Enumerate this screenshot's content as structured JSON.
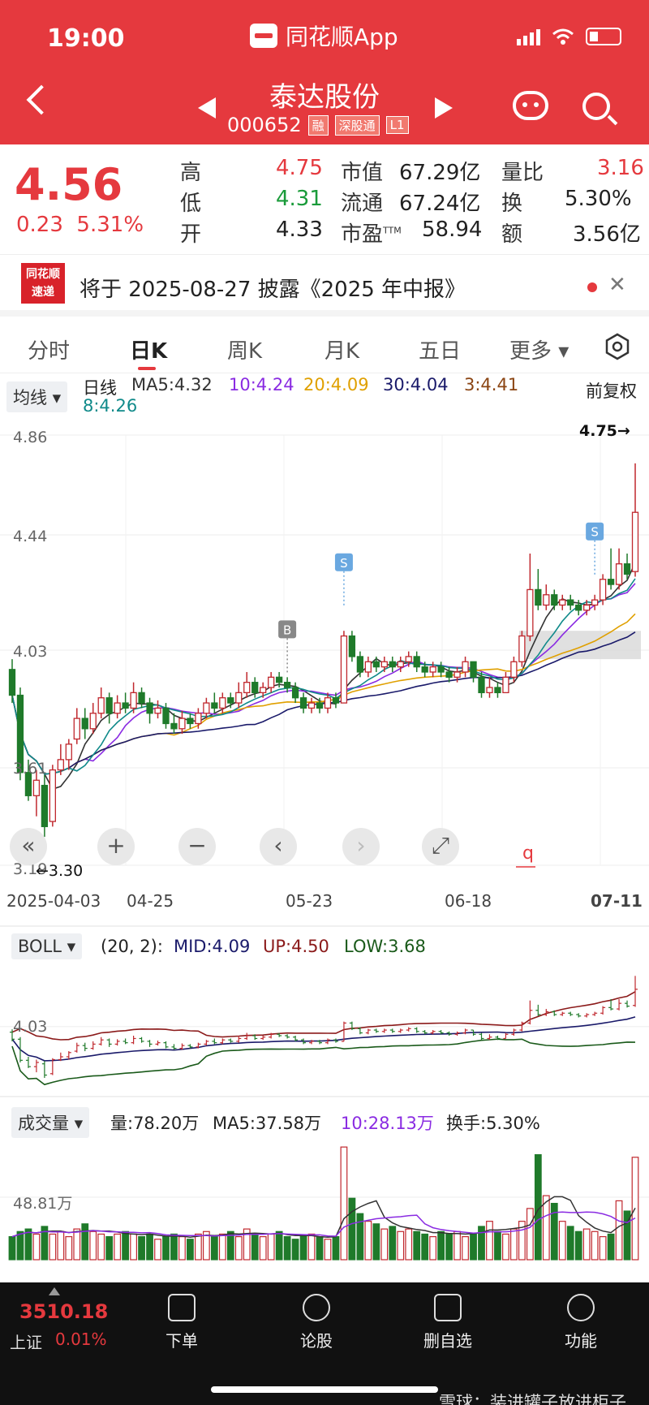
{
  "status_bar": {
    "time": "19:00",
    "app_name": "同花顺App"
  },
  "header": {
    "stock_name": "泰达股份",
    "stock_code": "000652",
    "tags": [
      "融",
      "深股通",
      "L1"
    ]
  },
  "quote": {
    "price": "4.56",
    "change": "0.23",
    "change_pct": "5.31%",
    "stats": [
      {
        "label": "高",
        "value": "4.75",
        "color": "#e5393e"
      },
      {
        "label": "低",
        "value": "4.31",
        "color": "#1a9b3a"
      },
      {
        "label": "开",
        "value": "4.33",
        "color": "#222222"
      },
      {
        "label": "市值",
        "value": "67.29亿",
        "color": "#222222"
      },
      {
        "label": "流通",
        "value": "67.24亿",
        "color": "#222222"
      },
      {
        "label": "市盈",
        "sup": "TTM",
        "value": "58.94",
        "color": "#222222"
      },
      {
        "label": "量比",
        "value": "3.16",
        "color": "#e5393e"
      },
      {
        "label": "换",
        "value": "5.30%",
        "color": "#222222"
      },
      {
        "label": "额",
        "value": "3.56亿",
        "color": "#222222"
      }
    ]
  },
  "news": {
    "logo_top": "同花顺",
    "logo_bottom": "速递",
    "text": "将于 2025-08-27 披露《2025 年中报》"
  },
  "tabs": [
    "分时",
    "日K",
    "周K",
    "月K",
    "五日",
    "更多"
  ],
  "active_tab": "日K",
  "ma_bar": {
    "selector": "均线",
    "label": "日线",
    "items": [
      {
        "text": "MA5:4.32",
        "color": "#333333"
      },
      {
        "text": "10:4.24",
        "color": "#8a2be2"
      },
      {
        "text": "20:4.09",
        "color": "#e0a000"
      },
      {
        "text": "30:4.04",
        "color": "#1a1a6a"
      },
      {
        "text": "3:4.41",
        "color": "#8b4513"
      },
      {
        "text": "8:4.26",
        "color": "#108a8a"
      }
    ],
    "adjust": "前复权"
  },
  "chart_data": {
    "type": "candlestick",
    "ylim": [
      3.19,
      4.86
    ],
    "y_ticks": [
      "4.86",
      "4.44",
      "4.03",
      "3.61",
      "3.19"
    ],
    "x_ticks": [
      "2025-04-03",
      "04-25",
      "05-23",
      "06-18",
      "07-11"
    ],
    "high_marker": "4.75",
    "low_marker": "3.30",
    "signals": [
      {
        "type": "B"
      },
      {
        "type": "S"
      },
      {
        "type": "S"
      }
    ],
    "candles": [
      [
        3.95,
        3.85,
        3.99,
        3.82
      ],
      [
        3.85,
        3.55,
        3.88,
        3.52
      ],
      [
        3.55,
        3.46,
        3.6,
        3.44
      ],
      [
        3.46,
        3.52,
        3.56,
        3.38
      ],
      [
        3.5,
        3.34,
        3.54,
        3.3
      ],
      [
        3.36,
        3.56,
        3.58,
        3.34
      ],
      [
        3.56,
        3.6,
        3.66,
        3.54
      ],
      [
        3.6,
        3.66,
        3.68,
        3.56
      ],
      [
        3.68,
        3.76,
        3.8,
        3.66
      ],
      [
        3.76,
        3.72,
        3.8,
        3.68
      ],
      [
        3.72,
        3.78,
        3.82,
        3.7
      ],
      [
        3.78,
        3.84,
        3.88,
        3.76
      ],
      [
        3.84,
        3.78,
        3.86,
        3.74
      ],
      [
        3.78,
        3.82,
        3.85,
        3.76
      ],
      [
        3.82,
        3.8,
        3.86,
        3.78
      ],
      [
        3.8,
        3.86,
        3.9,
        3.78
      ],
      [
        3.86,
        3.82,
        3.88,
        3.8
      ],
      [
        3.82,
        3.78,
        3.84,
        3.74
      ],
      [
        3.78,
        3.8,
        3.83,
        3.76
      ],
      [
        3.8,
        3.74,
        3.82,
        3.72
      ],
      [
        3.74,
        3.72,
        3.78,
        3.7
      ],
      [
        3.72,
        3.76,
        3.79,
        3.7
      ],
      [
        3.76,
        3.74,
        3.78,
        3.72
      ],
      [
        3.74,
        3.78,
        3.8,
        3.72
      ],
      [
        3.78,
        3.82,
        3.84,
        3.76
      ],
      [
        3.82,
        3.8,
        3.86,
        3.78
      ],
      [
        3.8,
        3.84,
        3.86,
        3.78
      ],
      [
        3.84,
        3.82,
        3.86,
        3.8
      ],
      [
        3.82,
        3.86,
        3.9,
        3.8
      ],
      [
        3.86,
        3.9,
        3.94,
        3.84
      ],
      [
        3.9,
        3.86,
        3.92,
        3.84
      ],
      [
        3.86,
        3.88,
        3.9,
        3.84
      ],
      [
        3.88,
        3.92,
        3.94,
        3.86
      ],
      [
        3.92,
        3.9,
        3.94,
        3.88
      ],
      [
        3.9,
        3.88,
        3.92,
        3.86
      ],
      [
        3.88,
        3.84,
        3.9,
        3.82
      ],
      [
        3.84,
        3.8,
        3.86,
        3.78
      ],
      [
        3.8,
        3.82,
        3.84,
        3.78
      ],
      [
        3.82,
        3.8,
        3.84,
        3.78
      ],
      [
        3.8,
        3.84,
        3.86,
        3.78
      ],
      [
        3.84,
        3.82,
        3.86,
        3.8
      ],
      [
        3.82,
        4.08,
        4.1,
        3.82
      ],
      [
        4.08,
        4.0,
        4.1,
        3.98
      ],
      [
        4.0,
        3.94,
        4.02,
        3.92
      ],
      [
        3.94,
        3.98,
        4.0,
        3.92
      ],
      [
        3.98,
        3.96,
        4.0,
        3.94
      ],
      [
        3.96,
        3.98,
        4.0,
        3.94
      ],
      [
        3.98,
        3.96,
        4.0,
        3.94
      ],
      [
        3.96,
        3.98,
        4.0,
        3.94
      ],
      [
        3.98,
        4.0,
        4.02,
        3.96
      ],
      [
        4.0,
        3.96,
        4.02,
        3.94
      ],
      [
        3.96,
        3.94,
        3.98,
        3.92
      ],
      [
        3.94,
        3.96,
        3.98,
        3.92
      ],
      [
        3.96,
        3.94,
        3.98,
        3.92
      ],
      [
        3.94,
        3.92,
        3.96,
        3.9
      ],
      [
        3.92,
        3.94,
        3.96,
        3.9
      ],
      [
        3.94,
        3.98,
        4.0,
        3.92
      ],
      [
        3.98,
        3.92,
        3.98,
        3.9
      ],
      [
        3.92,
        3.86,
        3.94,
        3.84
      ],
      [
        3.86,
        3.88,
        3.92,
        3.84
      ],
      [
        3.88,
        3.86,
        3.9,
        3.84
      ],
      [
        3.86,
        3.92,
        3.94,
        3.86
      ],
      [
        3.92,
        3.98,
        4.0,
        3.9
      ],
      [
        3.98,
        4.08,
        4.1,
        3.96
      ],
      [
        4.08,
        4.26,
        4.4,
        4.06
      ],
      [
        4.26,
        4.2,
        4.34,
        4.18
      ],
      [
        4.2,
        4.24,
        4.28,
        4.18
      ],
      [
        4.24,
        4.2,
        4.26,
        4.18
      ],
      [
        4.2,
        4.22,
        4.24,
        4.18
      ],
      [
        4.22,
        4.2,
        4.24,
        4.18
      ],
      [
        4.2,
        4.18,
        4.22,
        4.16
      ],
      [
        4.18,
        4.2,
        4.22,
        4.16
      ],
      [
        4.2,
        4.22,
        4.24,
        4.18
      ],
      [
        4.22,
        4.3,
        4.32,
        4.2
      ],
      [
        4.3,
        4.28,
        4.42,
        4.26
      ],
      [
        4.28,
        4.36,
        4.42,
        4.26
      ],
      [
        4.36,
        4.32,
        4.4,
        4.3
      ],
      [
        4.33,
        4.56,
        4.75,
        4.31
      ]
    ]
  },
  "controls": [
    "«",
    "+",
    "−",
    "‹",
    "›",
    "⤢"
  ],
  "boll": {
    "selector": "BOLL",
    "params": "(20, 2):",
    "mid": "MID:4.09",
    "up": "UP:4.50",
    "low": "LOW:3.68",
    "y_label": "4.03"
  },
  "volume": {
    "selector": "成交量",
    "vol": "量:78.20万",
    "ma5": "MA5:37.58万",
    "ma10": "10:28.13万",
    "turnover": "换手:5.30%",
    "y_label": "48.81万",
    "values": [
      18,
      22,
      24,
      20,
      26,
      20,
      22,
      18,
      24,
      28,
      22,
      20,
      18,
      20,
      22,
      20,
      18,
      20,
      16,
      18,
      20,
      18,
      16,
      20,
      22,
      18,
      20,
      22,
      18,
      24,
      20,
      18,
      20,
      22,
      18,
      16,
      18,
      20,
      18,
      16,
      18,
      88,
      48,
      36,
      30,
      28,
      24,
      26,
      22,
      24,
      22,
      20,
      18,
      22,
      20,
      22,
      18,
      20,
      26,
      30,
      22,
      20,
      24,
      30,
      40,
      82,
      50,
      44,
      30,
      26,
      22,
      24,
      22,
      18,
      20,
      46,
      38,
      80
    ]
  },
  "bottom_bar": {
    "index_value": "3510.18",
    "index_name": "上证",
    "index_pct": "0.01%",
    "nav": [
      "下单",
      "论股",
      "删自选",
      "功能"
    ],
    "watermark": "雪球：装进罐子放进柜子"
  }
}
